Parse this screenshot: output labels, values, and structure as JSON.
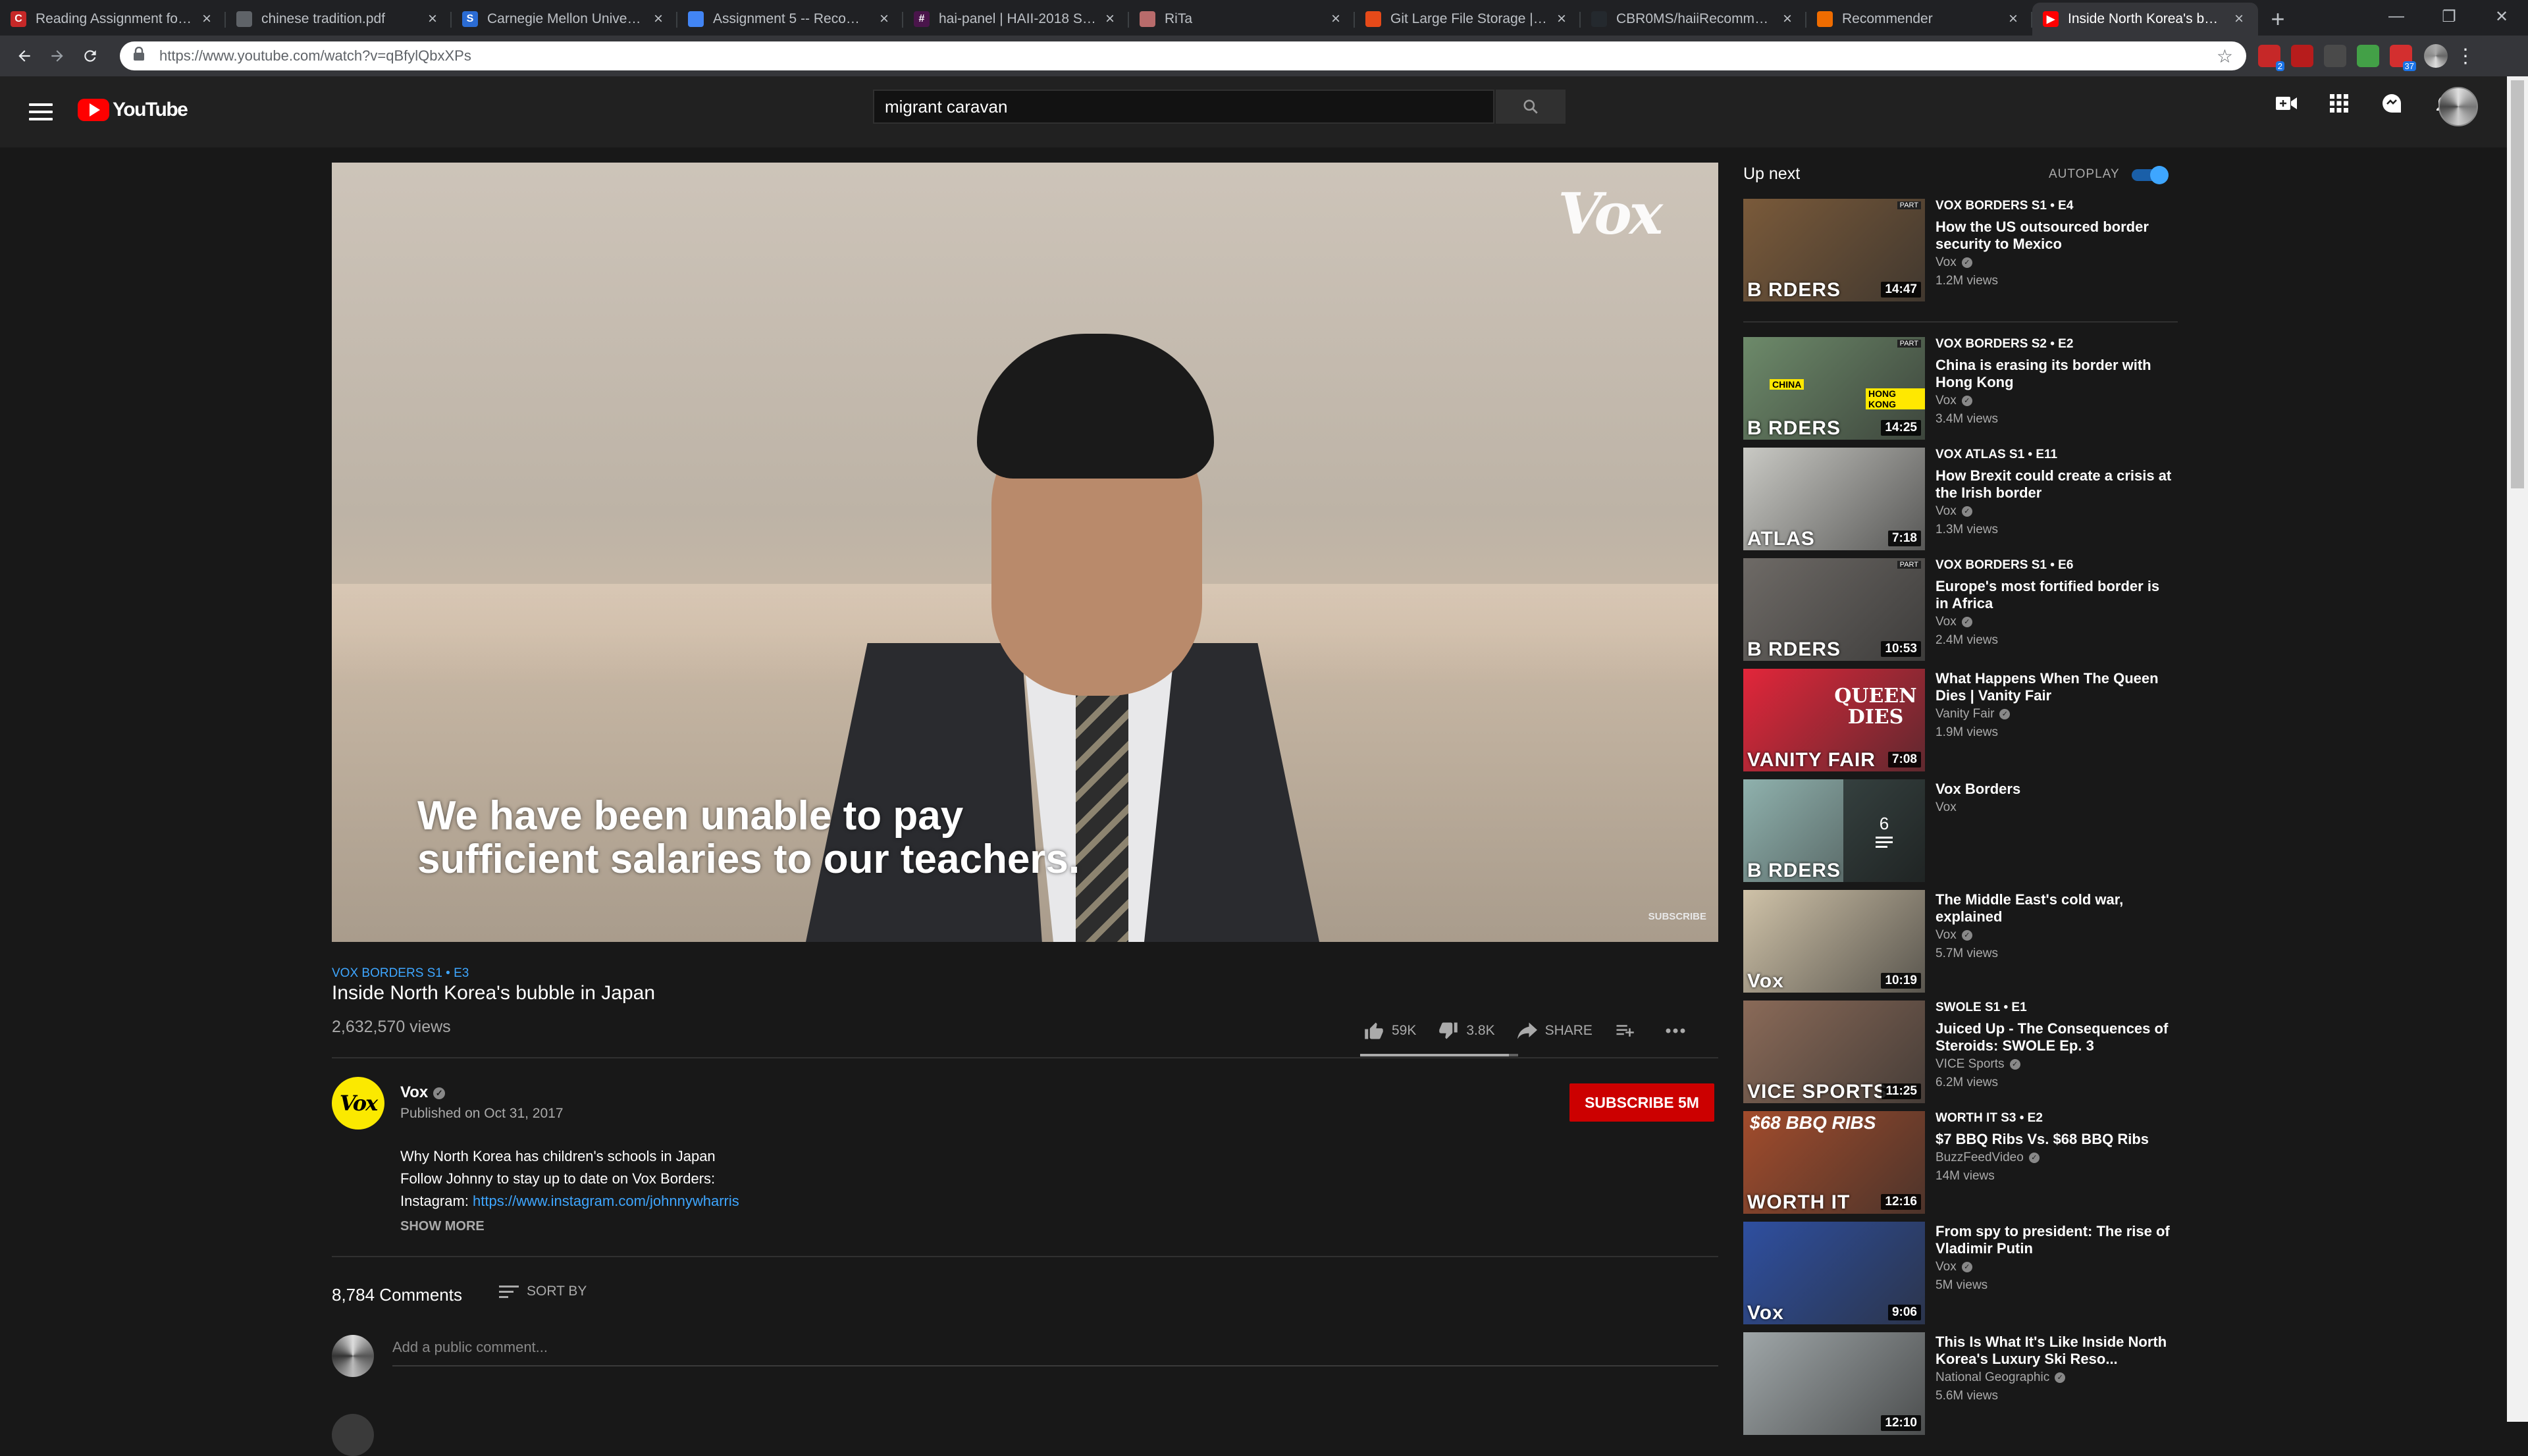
{
  "browser": {
    "tabs": [
      {
        "title": "Reading Assignment for We",
        "fav_color": "#c62828",
        "fav_glyph": "C"
      },
      {
        "title": "chinese tradition.pdf",
        "fav_color": "#5f6368",
        "fav_glyph": ""
      },
      {
        "title": "Carnegie Mellon University",
        "fav_color": "#2b6cd4",
        "fav_glyph": "S"
      },
      {
        "title": "Assignment 5 -- Recommen",
        "fav_color": "#4285f4",
        "fav_glyph": ""
      },
      {
        "title": "hai-panel | HAII-2018 Slack",
        "fav_color": "#4a154b",
        "fav_glyph": "#"
      },
      {
        "title": "RiTa",
        "fav_color": "#b86b6b",
        "fav_glyph": ""
      },
      {
        "title": "Git Large File Storage | Git L",
        "fav_color": "#e64a19",
        "fav_glyph": ""
      },
      {
        "title": "CBR0MS/haiiRecommende",
        "fav_color": "#24292e",
        "fav_glyph": ""
      },
      {
        "title": "Recommender",
        "fav_color": "#ef6c00",
        "fav_glyph": ""
      },
      {
        "title": "Inside North Korea's bubble",
        "fav_color": "#ff0000",
        "fav_glyph": "▶"
      }
    ],
    "close_glyph": "×",
    "new_tab_glyph": "+",
    "window_controls": {
      "minimize": "—",
      "restore": "❐",
      "close": "✕"
    },
    "url": "https://www.youtube.com/watch?v=qBfylQbxXPs",
    "extension_badges": [
      "2",
      "",
      "",
      "",
      "37"
    ]
  },
  "youtube": {
    "logo_text": "YouTube",
    "search_value": "migrant caravan",
    "search_icon": "⚲"
  },
  "player": {
    "caption_line1": "We have been unable to pay",
    "caption_line2": "sufficient salaries to our teachers.",
    "watermark": "Vox",
    "subscribe_watermark": "SUBSCRIBE"
  },
  "video": {
    "series_tag": "VOX BORDERS  S1 • E3",
    "title": "Inside North Korea's bubble in Japan",
    "views": "2,632,570 views",
    "likes": "59K",
    "dislikes": "3.8K",
    "share_label": "SHARE",
    "like_ratio": 0.94
  },
  "channel": {
    "avatar_text": "Vox",
    "name": "Vox",
    "published": "Published on Oct 31, 2017",
    "subscribe_label": "SUBSCRIBE  5M",
    "desc_line1": "Why North Korea has children's schools in Japan",
    "desc_line2": "Follow Johnny to stay up to date on Vox Borders:",
    "desc_line3_prefix": "Instagram: ",
    "desc_link": "https://www.instagram.com/johnnywharris",
    "show_more": "SHOW MORE"
  },
  "comments": {
    "count": "8,784 Comments",
    "sort_by": "SORT BY",
    "placeholder": "Add a public comment..."
  },
  "sidebar": {
    "up_next": "Up next",
    "autoplay": "AUTOPLAY",
    "autoplay_on": true,
    "items": [
      {
        "series": "VOX BORDERS  S1 • E4",
        "title": "How the US outsourced border security to Mexico",
        "channel": "Vox",
        "views": "1.2M views",
        "duration": "14:47",
        "thumb_text": "B  RDERS",
        "bg": "#7a5a3a"
      },
      {
        "series": "VOX BORDERS  S2 • E2",
        "title": "China is erasing its border with Hong Kong",
        "channel": "Vox",
        "views": "3.4M views",
        "duration": "14:25",
        "thumb_text": "B  RDERS",
        "thumb_tag1": "CHINA",
        "thumb_tag2": "HONG KONG",
        "bg": "#6d8a6a"
      },
      {
        "series": "VOX ATLAS  S1 • E11",
        "title": "How Brexit could create a crisis at the Irish border",
        "channel": "Vox",
        "views": "1.3M views",
        "duration": "7:18",
        "thumb_text": "ATLAS",
        "bg": "#c9c9c4"
      },
      {
        "series": "VOX BORDERS  S1 • E6",
        "title": "Europe's most fortified border is in Africa",
        "channel": "Vox",
        "views": "2.4M views",
        "duration": "10:53",
        "thumb_text": "B  RDERS",
        "bg": "#6e6a66"
      },
      {
        "series": "",
        "title": "What Happens When The Queen Dies | Vanity Fair",
        "channel": "Vanity Fair",
        "views": "1.9M views",
        "duration": "7:08",
        "thumb_text": "VANITY FAIR",
        "thumb_big": "QUEEN DIES",
        "bg": "#e2263a"
      },
      {
        "series": "",
        "title": "Vox Borders",
        "channel": "Vox",
        "views": "",
        "duration": "",
        "thumb_text": "B  RDERS",
        "playlist_count": "6",
        "bg": "#8fb1ad"
      },
      {
        "series": "",
        "title": "The Middle East's cold war, explained",
        "channel": "Vox",
        "views": "5.7M views",
        "duration": "10:19",
        "thumb_text": "Vox",
        "bg": "#cfc2a8"
      },
      {
        "series": "SWOLE  S1 • E1",
        "title": "Juiced Up - The Consequences of Steroids: SWOLE Ep. 3",
        "channel": "VICE Sports",
        "views": "6.2M views",
        "duration": "11:25",
        "thumb_text": "VICE SPORTS",
        "bg": "#8a6a58"
      },
      {
        "series": "WORTH IT  S3 • E2",
        "title": "$7 BBQ Ribs Vs. $68 BBQ Ribs",
        "channel": "BuzzFeedVideo",
        "views": "14M views",
        "duration": "12:16",
        "thumb_text": "WORTH IT",
        "thumb_big": "$68 BBQ RIBS",
        "bg": "#a24c2c"
      },
      {
        "series": "",
        "title": "From spy to president: The rise of Vladimir Putin",
        "channel": "Vox",
        "views": "5M views",
        "duration": "9:06",
        "thumb_text": "Vox",
        "bg": "#2e4fa0"
      },
      {
        "series": "",
        "title": "This Is What It's Like Inside North Korea's Luxury Ski Reso...",
        "channel": "National Geographic",
        "views": "5.6M views",
        "duration": "12:10",
        "thumb_text": "",
        "bg": "#9fa6a8"
      }
    ]
  },
  "colors": {
    "bg": "#181818",
    "masthead": "#212121",
    "accent_red": "#cc0000",
    "link_blue": "#3ea6ff"
  }
}
